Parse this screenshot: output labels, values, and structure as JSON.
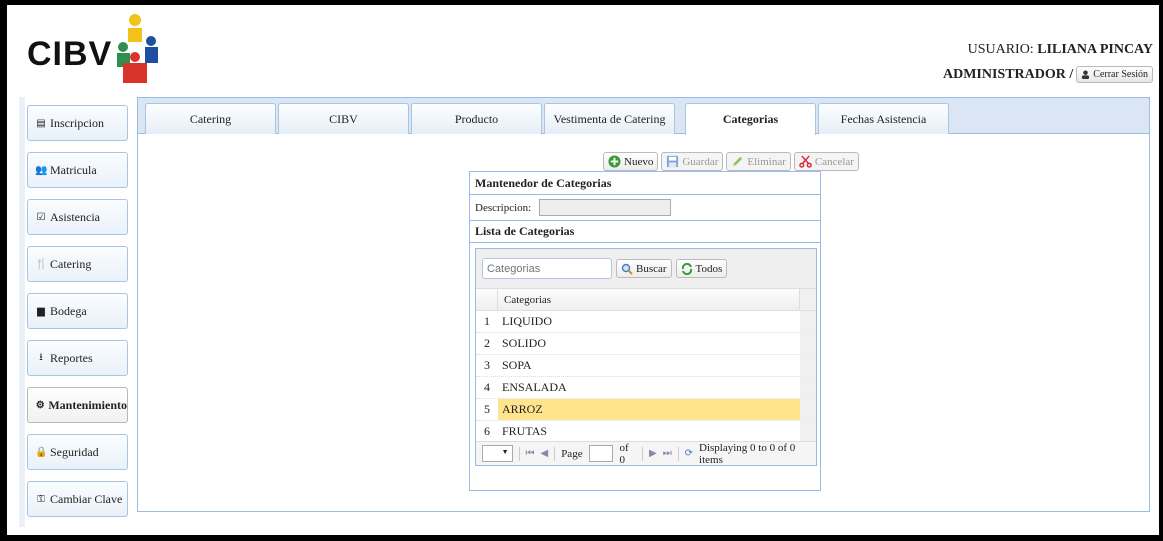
{
  "header": {
    "logo_text": "CIBV",
    "user_label": "USUARIO:",
    "user_name": "LILIANA PINCAY",
    "role": "ADMINISTRADOR /",
    "logout_label": "Cerrar Sesión"
  },
  "sidebar": {
    "items": [
      {
        "label": "Inscripcion",
        "icon": "list-icon"
      },
      {
        "label": "Matricula",
        "icon": "users-icon"
      },
      {
        "label": "Asistencia",
        "icon": "checkbox-icon"
      },
      {
        "label": "Catering",
        "icon": "cutlery-icon"
      },
      {
        "label": "Bodega",
        "icon": "box-icon"
      },
      {
        "label": "Reportes",
        "icon": "download-icon"
      },
      {
        "label": "Mantenimiento",
        "icon": "cogs-icon"
      },
      {
        "label": "Seguridad",
        "icon": "lock-icon"
      },
      {
        "label": "Cambiar Clave",
        "icon": "key-icon"
      }
    ],
    "active": "Mantenimiento"
  },
  "tabs": [
    {
      "label": "Catering"
    },
    {
      "label": "CIBV"
    },
    {
      "label": "Producto"
    },
    {
      "label": "Vestimenta de Catering"
    },
    {
      "label": "Categorias"
    },
    {
      "label": "Fechas Asistencia"
    }
  ],
  "active_tab": "Categorias",
  "toolbar": {
    "new_label": "Nuevo",
    "save_label": "Guardar",
    "delete_label": "Eliminar",
    "cancel_label": "Cancelar"
  },
  "form": {
    "title": "Mantenedor de Categorias",
    "description_label": "Descripcion:",
    "description_value": ""
  },
  "list": {
    "title": "Lista de Categorias",
    "search_placeholder": "Categorias",
    "search_label": "Buscar",
    "all_label": "Todos",
    "column_header": "Categorias",
    "rows": [
      {
        "num": "1",
        "name": "LIQUIDO"
      },
      {
        "num": "2",
        "name": "SOLIDO"
      },
      {
        "num": "3",
        "name": "SOPA"
      },
      {
        "num": "4",
        "name": "ENSALADA"
      },
      {
        "num": "5",
        "name": "ARROZ"
      },
      {
        "num": "6",
        "name": "FRUTAS"
      }
    ],
    "selected_row": "5"
  },
  "pager": {
    "page_label": "Page",
    "page_value": "",
    "of_label": "of 0",
    "display_text": "Displaying 0 to 0 of 0 items"
  },
  "colors": {
    "accent_border": "#99bbe8",
    "tabbar_bg": "#dae6f4",
    "selected_row": "#ffe48d"
  }
}
